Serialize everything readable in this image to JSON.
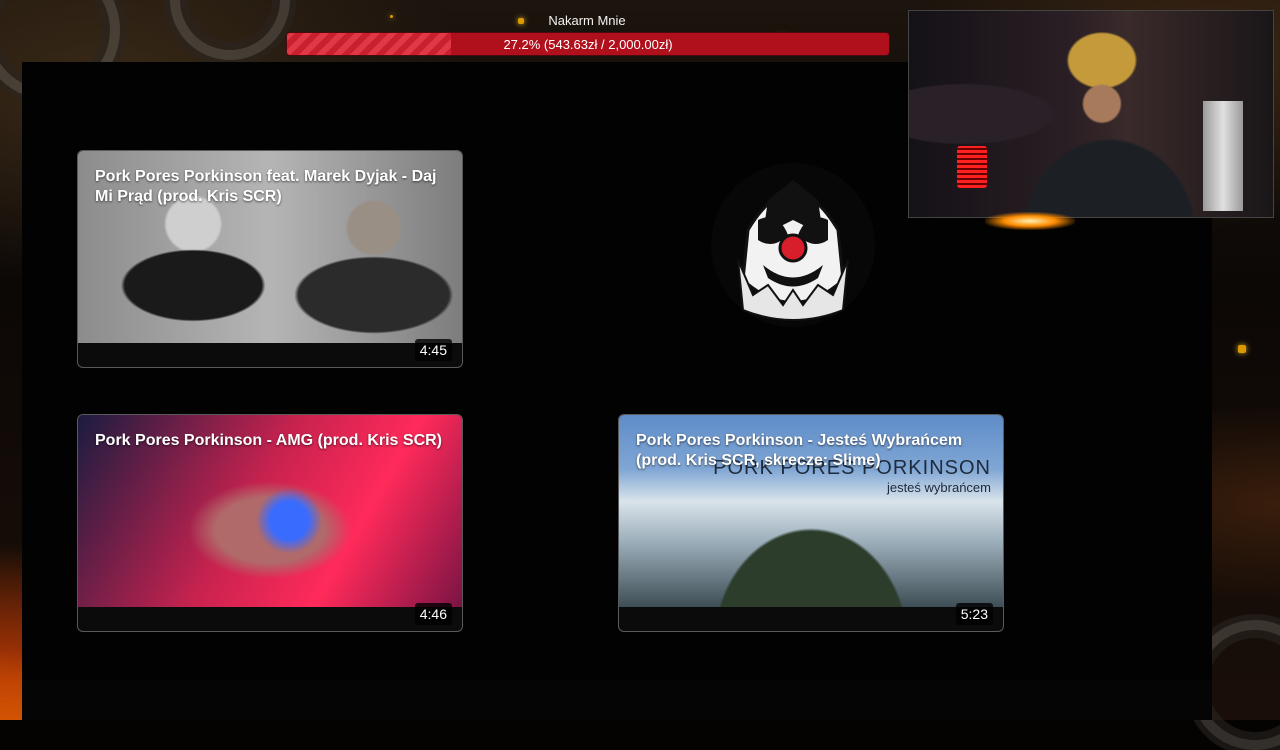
{
  "donation_goal": {
    "title": "Nakarm Mnie",
    "progress_percent": 27.2,
    "progress_text": "27.2% (543.63zł / 2,000.00zł)",
    "bar_color": "#b0101c"
  },
  "videos": [
    {
      "title": "Pork Pores Porkinson feat. Marek Dyjak - Daj Mi Prąd (prod. Kris SCR)",
      "duration": "4:45"
    },
    {
      "title": "Pork Pores Porkinson - AMG (prod. Kris SCR)",
      "duration": "4:46"
    },
    {
      "title": "Pork Pores Porkinson - Jesteś Wybrańcem (prod. Kris SCR, skrecze: Slime)",
      "duration": "5:23",
      "thumbnail_text": {
        "line1": "PORK PORES PORKINSON",
        "line2": "jesteś wybrańcem"
      }
    }
  ],
  "logo": {
    "icon": "clown-face-icon"
  },
  "webcam": {
    "icon": "webcam-feed"
  }
}
